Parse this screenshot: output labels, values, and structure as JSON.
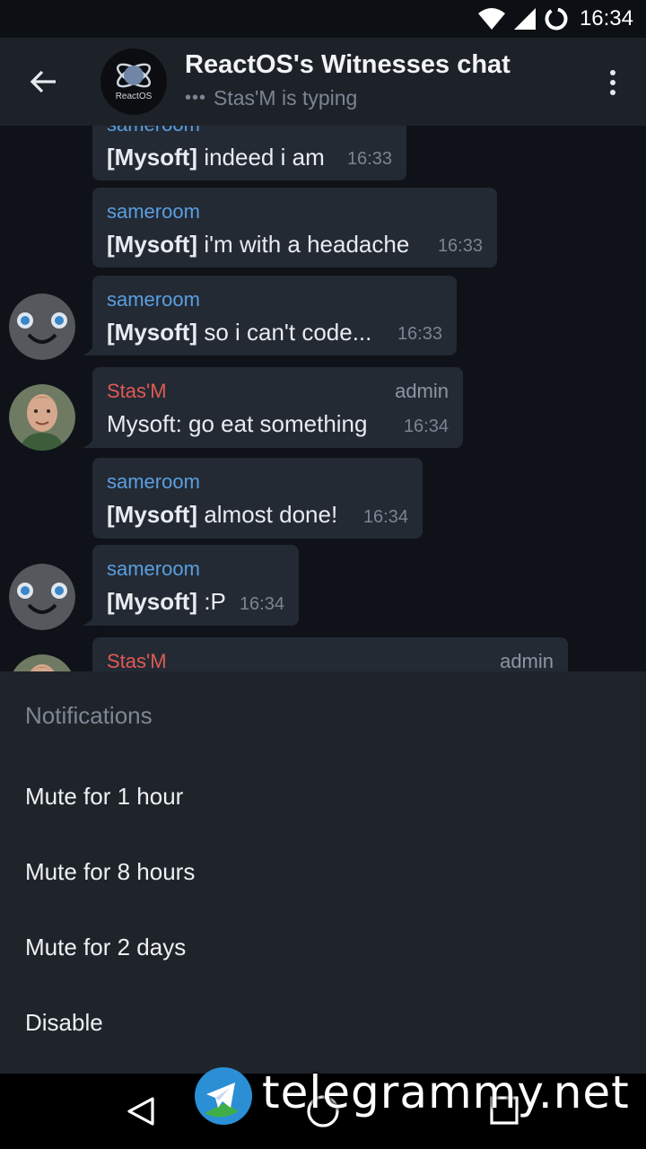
{
  "status_bar": {
    "time": "16:34"
  },
  "header": {
    "title": "ReactOS's Witnesses chat",
    "typing_dots": "•••",
    "subtitle": "Stas'M is typing",
    "avatar_label": "ReactOS"
  },
  "messages": [
    {
      "sender": "sameroom",
      "prefix": "[Mysoft]",
      "text": " indeed i am",
      "time": "16:33"
    },
    {
      "sender": "sameroom",
      "prefix": "[Mysoft]",
      "text": " i'm with a headache",
      "time": "16:33"
    },
    {
      "sender": "sameroom",
      "prefix": "[Mysoft]",
      "text": " so i can't code...",
      "time": "16:33"
    },
    {
      "sender": "Stas'M",
      "role": "admin",
      "text": "Mysoft: go eat something",
      "time": "16:34"
    },
    {
      "sender": "sameroom",
      "prefix": "[Mysoft]",
      "text": " almost done!",
      "time": "16:34"
    },
    {
      "sender": "sameroom",
      "prefix": "[Mysoft]",
      "text": " :P",
      "time": "16:34"
    },
    {
      "sender": "Stas'M",
      "role": "admin"
    }
  ],
  "notifications": {
    "title": "Notifications",
    "options": [
      "Mute for 1 hour",
      "Mute for 8 hours",
      "Mute for 2 days",
      "Disable"
    ]
  },
  "watermark": {
    "text": "telegrammy.net"
  },
  "colors": {
    "sender_blue": "#5a9fe0",
    "sender_red": "#e05a52",
    "bubble": "#232a34",
    "sheet": "#1f242b"
  }
}
